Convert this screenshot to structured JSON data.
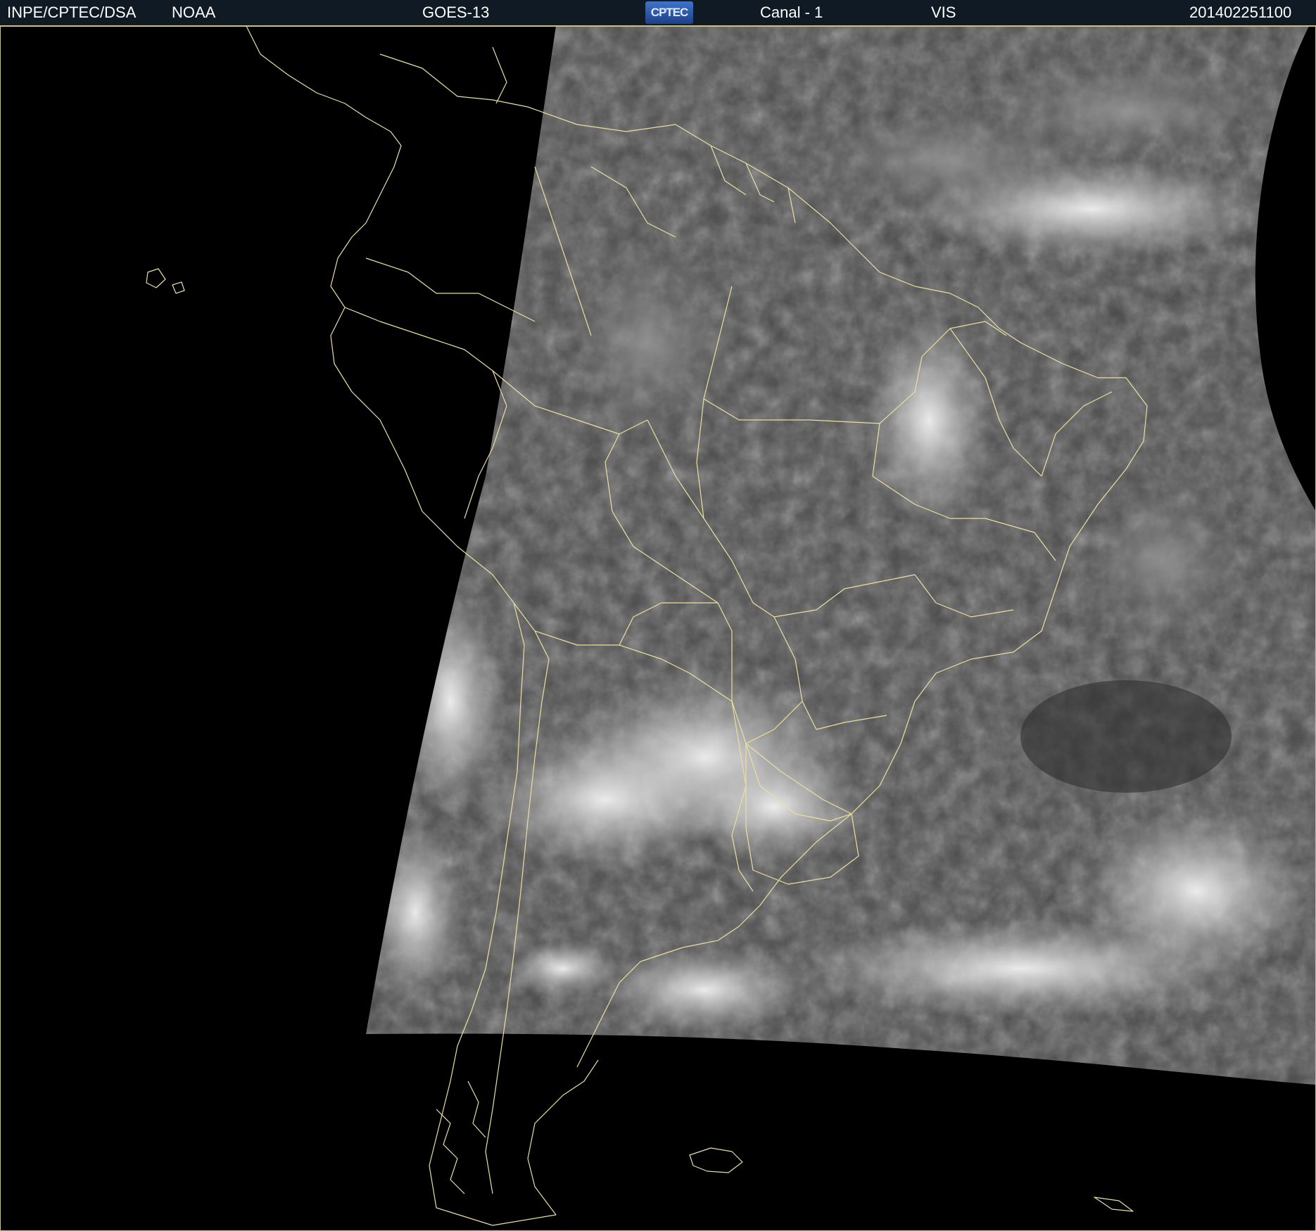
{
  "header": {
    "agency": "INPE/CPTEC/DSA",
    "partner": "NOAA",
    "satellite": "GOES-13",
    "logo": "CPTEC",
    "channel": "Canal - 1",
    "band": "VIS",
    "timestamp": "201402251100"
  },
  "map": {
    "region": "South America",
    "colors": {
      "background": "#000000",
      "border_lines": "#e8e0a0",
      "header_bg": "#0f1a24"
    }
  }
}
